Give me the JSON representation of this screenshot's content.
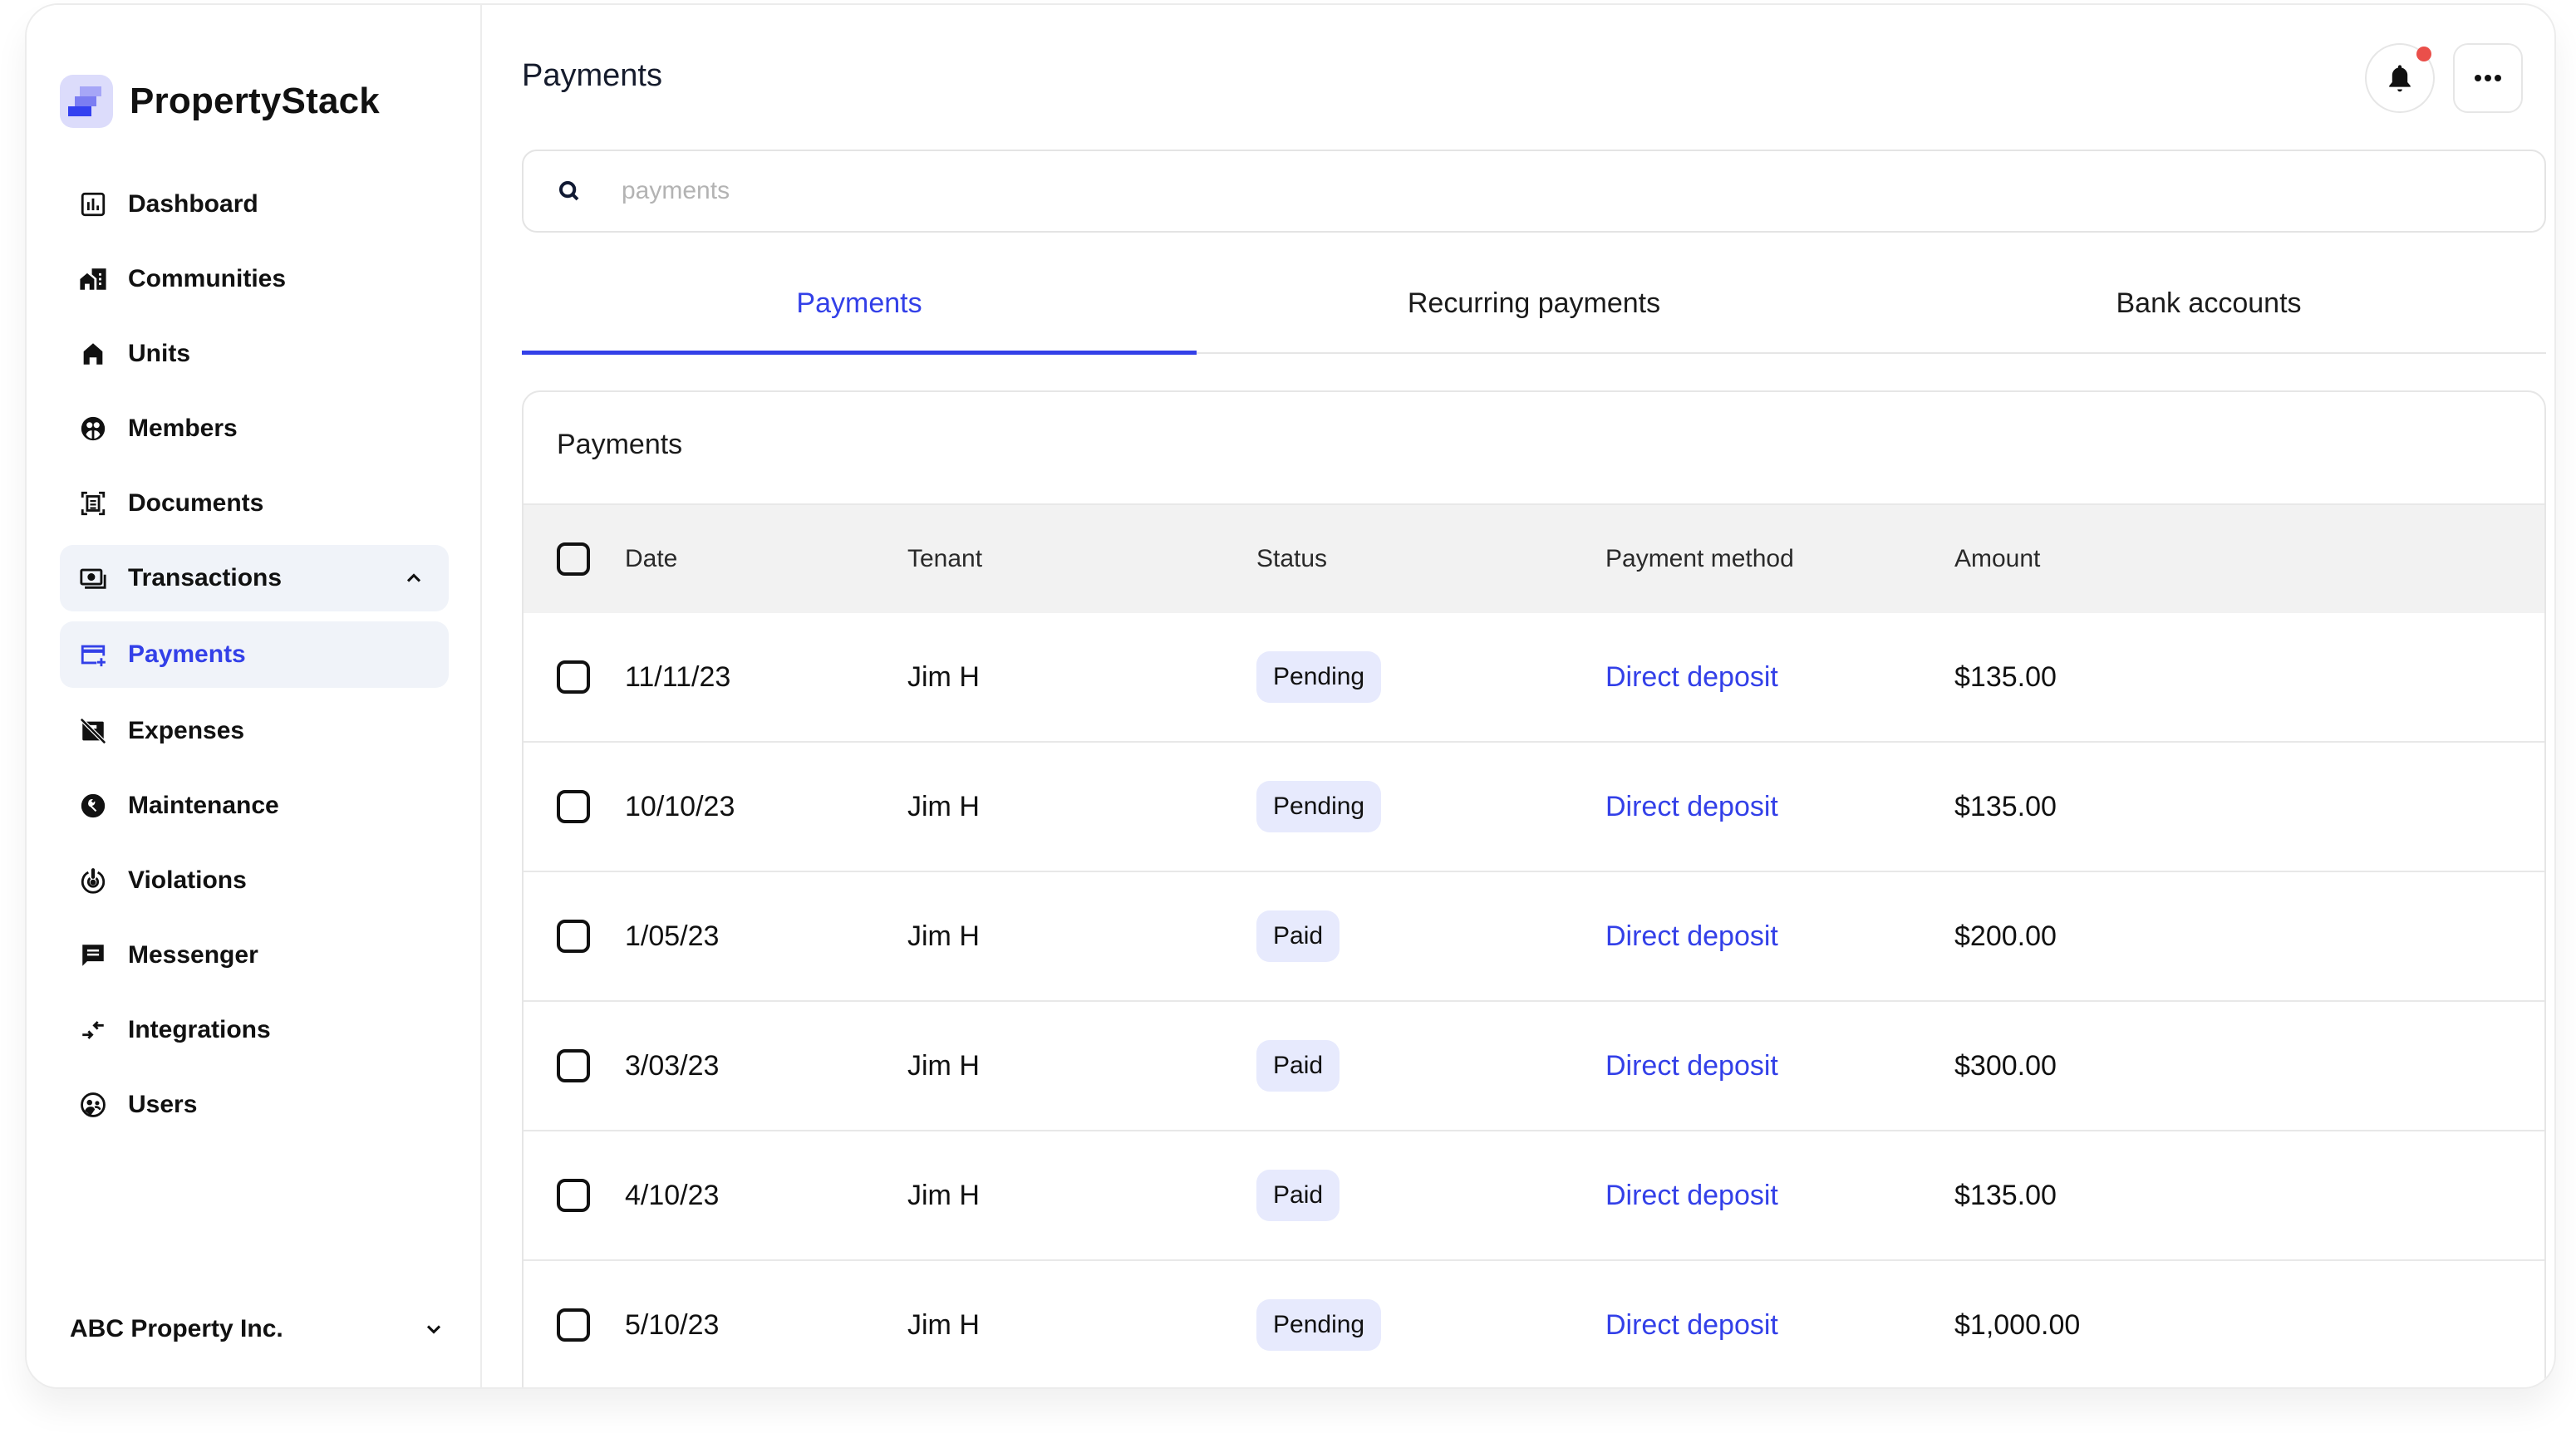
{
  "brand": {
    "name": "PropertyStack",
    "logo_icon": "stacked-bars-logo"
  },
  "sidebar": {
    "items": [
      {
        "label": "Dashboard",
        "icon": "dashboard-chart-icon"
      },
      {
        "label": "Communities",
        "icon": "communities-building-icon"
      },
      {
        "label": "Units",
        "icon": "home-icon"
      },
      {
        "label": "Members",
        "icon": "members-group-icon"
      },
      {
        "label": "Documents",
        "icon": "document-scan-icon"
      },
      {
        "label": "Transactions",
        "icon": "money-icon",
        "expanded": true,
        "chevron": "chevron-up-icon"
      },
      {
        "label": "Payments",
        "icon": "credit-card-plus-icon",
        "active": true
      },
      {
        "label": "Expenses",
        "icon": "card-off-icon"
      },
      {
        "label": "Maintenance",
        "icon": "wrench-icon"
      },
      {
        "label": "Violations",
        "icon": "alert-target-icon"
      },
      {
        "label": "Messenger",
        "icon": "chat-icon"
      },
      {
        "label": "Integrations",
        "icon": "arrows-swap-icon"
      },
      {
        "label": "Users",
        "icon": "users-icon"
      }
    ],
    "org": {
      "name": "ABC Property Inc.",
      "chevron": "chevron-down-icon"
    }
  },
  "header": {
    "title": "Payments",
    "notifications": {
      "icon": "bell-icon",
      "has_unread": true
    },
    "more": {
      "icon": "more-horizontal-icon"
    }
  },
  "search": {
    "placeholder": "payments",
    "value": ""
  },
  "tabs": [
    {
      "label": "Payments",
      "active": true
    },
    {
      "label": "Recurring payments",
      "active": false
    },
    {
      "label": "Bank accounts",
      "active": false
    }
  ],
  "table": {
    "title": "Payments",
    "columns": [
      "Date",
      "Tenant",
      "Status",
      "Payment method",
      "Amount"
    ],
    "rows": [
      {
        "date": "11/11/23",
        "tenant": "Jim H",
        "status": "Pending",
        "method": "Direct deposit",
        "amount": "$135.00"
      },
      {
        "date": "10/10/23",
        "tenant": "Jim H",
        "status": "Pending",
        "method": "Direct deposit",
        "amount": "$135.00"
      },
      {
        "date": "1/05/23",
        "tenant": "Jim H",
        "status": "Paid",
        "method": "Direct deposit",
        "amount": "$200.00"
      },
      {
        "date": "3/03/23",
        "tenant": "Jim H",
        "status": "Paid",
        "method": "Direct deposit",
        "amount": "$300.00"
      },
      {
        "date": "4/10/23",
        "tenant": "Jim H",
        "status": "Paid",
        "method": "Direct deposit",
        "amount": "$135.00"
      },
      {
        "date": "5/10/23",
        "tenant": "Jim H",
        "status": "Pending",
        "method": "Direct deposit",
        "amount": "$1,000.00"
      }
    ]
  },
  "colors": {
    "accent": "#3340e8",
    "badge_bg": "#e7eafd",
    "notification_dot": "#ea4f4a",
    "header_row_bg": "#f2f2f2",
    "active_nav_bg": "#f0f3f9"
  }
}
